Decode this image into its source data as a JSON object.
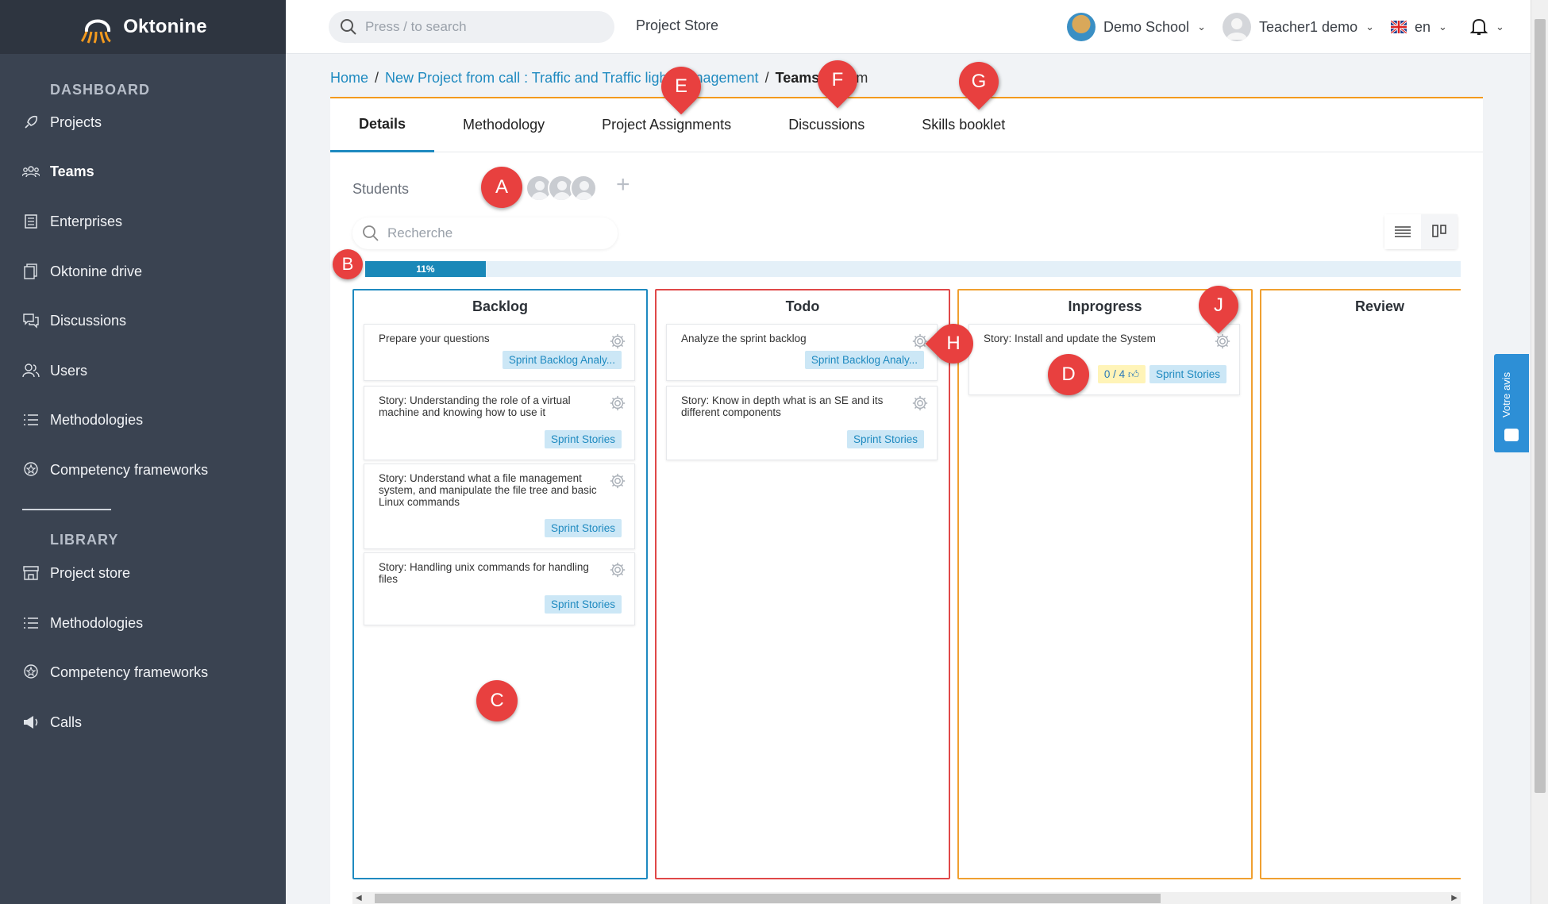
{
  "app": {
    "name": "Oktonine"
  },
  "sidebar": {
    "section1": "DASHBOARD",
    "section2": "LIBRARY",
    "items": [
      {
        "label": "Projects",
        "icon": "rocket-icon"
      },
      {
        "label": "Teams",
        "icon": "team-icon"
      },
      {
        "label": "Enterprises",
        "icon": "building-icon"
      },
      {
        "label": "Oktonine drive",
        "icon": "drive-icon"
      },
      {
        "label": "Discussions",
        "icon": "chat-icon"
      },
      {
        "label": "Users",
        "icon": "users-icon"
      },
      {
        "label": "Methodologies",
        "icon": "list-icon"
      },
      {
        "label": "Competency frameworks",
        "icon": "badge-icon"
      },
      {
        "label": "Project store",
        "icon": "store-icon"
      },
      {
        "label": "Methodologies",
        "icon": "list-icon"
      },
      {
        "label": "Competency frameworks",
        "icon": "badge-icon"
      },
      {
        "label": "Calls",
        "icon": "megaphone-icon"
      }
    ]
  },
  "header": {
    "search_placeholder": "Press / to search",
    "project_store": "Project Store",
    "school": "Demo School",
    "user": "Teacher1 demo",
    "lang": "en"
  },
  "breadcrumb": {
    "home": "Home",
    "project": "New Project from call : Traffic and Traffic light management",
    "teams": "Teams",
    "team": "team"
  },
  "tabs": [
    "Details",
    "Methodology",
    "Project Assignments",
    "Discussions",
    "Skills booklet"
  ],
  "students_label": "Students",
  "filter_placeholder": "Recherche",
  "progress": {
    "value": 0.11,
    "label": "11%"
  },
  "columns": [
    {
      "title": "Backlog",
      "color": "#1f8ac0",
      "tasks": [
        {
          "text": "Prepare your questions",
          "tag": "Sprint Backlog Analy..."
        },
        {
          "text": "Story: Understanding the role of a virtual machine and knowing how to use it",
          "tag": "Sprint Stories"
        },
        {
          "text": "Story: Understand what a file management system, and manipulate the file tree and basic Linux commands",
          "tag": "Sprint Stories"
        },
        {
          "text": "Story: Handling unix commands for handling files",
          "tag": "Sprint Stories"
        }
      ]
    },
    {
      "title": "Todo",
      "color": "#e04848",
      "tasks": [
        {
          "text": "Analyze the sprint backlog",
          "tag": "Sprint Backlog Analy..."
        },
        {
          "text": "Story: Know in depth what is an SE and its different components",
          "tag": "Sprint Stories"
        }
      ]
    },
    {
      "title": "Inprogress",
      "color": "#f0a030",
      "tasks": [
        {
          "text": "Story: Install and update the System",
          "tag": "Sprint Stories",
          "rating": "0 / 4"
        }
      ]
    },
    {
      "title": "Review",
      "color": "#f0a030",
      "tasks": []
    }
  ],
  "feedback": "Votre avis",
  "markers": [
    "A",
    "B",
    "C",
    "D",
    "E",
    "F",
    "G",
    "H",
    "J"
  ]
}
